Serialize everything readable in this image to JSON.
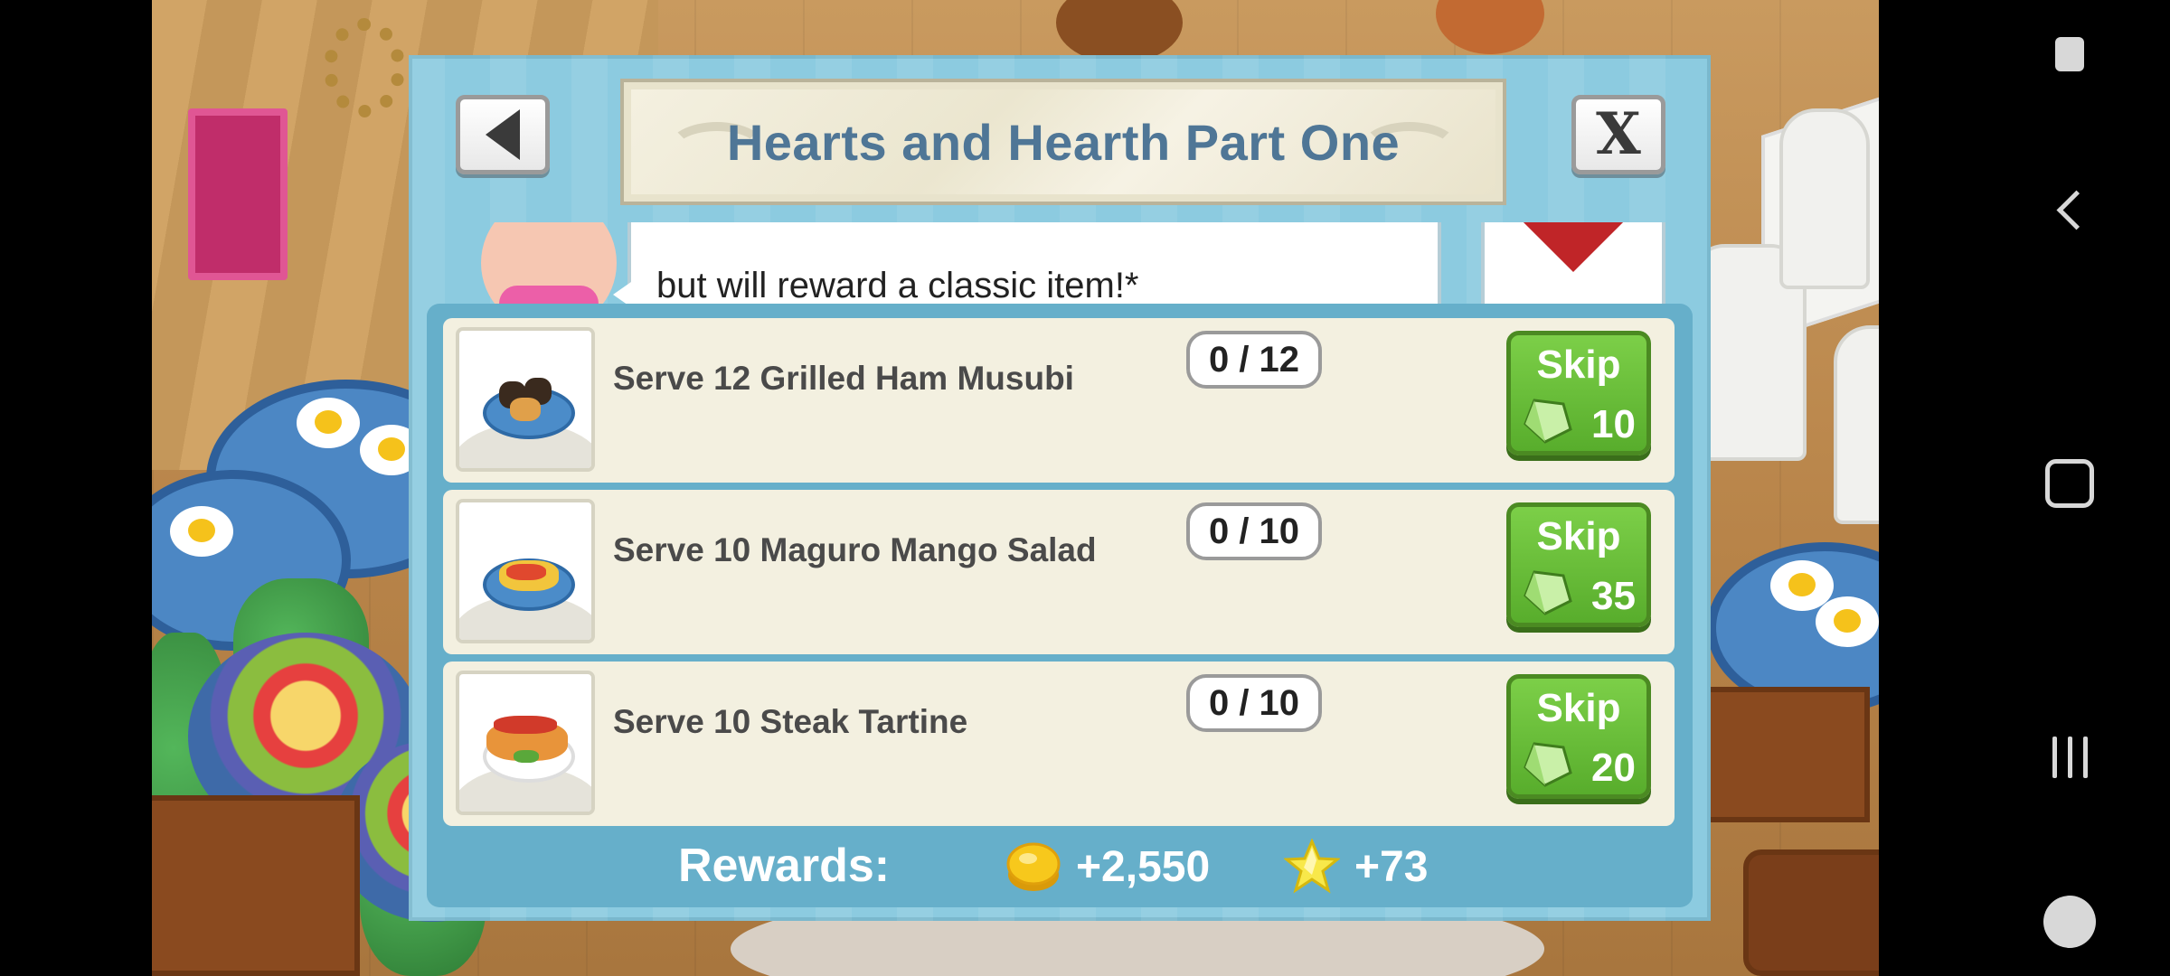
{
  "dialog": {
    "title": "Hearts and Hearth Part One",
    "intro_text": "but will reward a classic item!*"
  },
  "tasks": [
    {
      "label": "Serve 12 Grilled Ham Musubi",
      "progress": "0 / 12",
      "skip_label": "Skip",
      "skip_cost": "10"
    },
    {
      "label": "Serve 10 Maguro Mango Salad",
      "progress": "0 / 10",
      "skip_label": "Skip",
      "skip_cost": "35"
    },
    {
      "label": "Serve 10 Steak Tartine",
      "progress": "0 / 10",
      "skip_label": "Skip",
      "skip_cost": "20"
    }
  ],
  "rewards": {
    "label": "Rewards:",
    "coins": "+2,550",
    "stars": "+73"
  },
  "colors": {
    "dialog_bg": "#8ccbe0",
    "task_panel": "#66afca",
    "title_text": "#4f7696",
    "skip_green": "#58ad2c"
  },
  "icons": {
    "back": "triangle-left-icon",
    "close": "close-x-icon",
    "gem": "gem-icon",
    "coin": "coin-icon",
    "star": "star-icon"
  }
}
